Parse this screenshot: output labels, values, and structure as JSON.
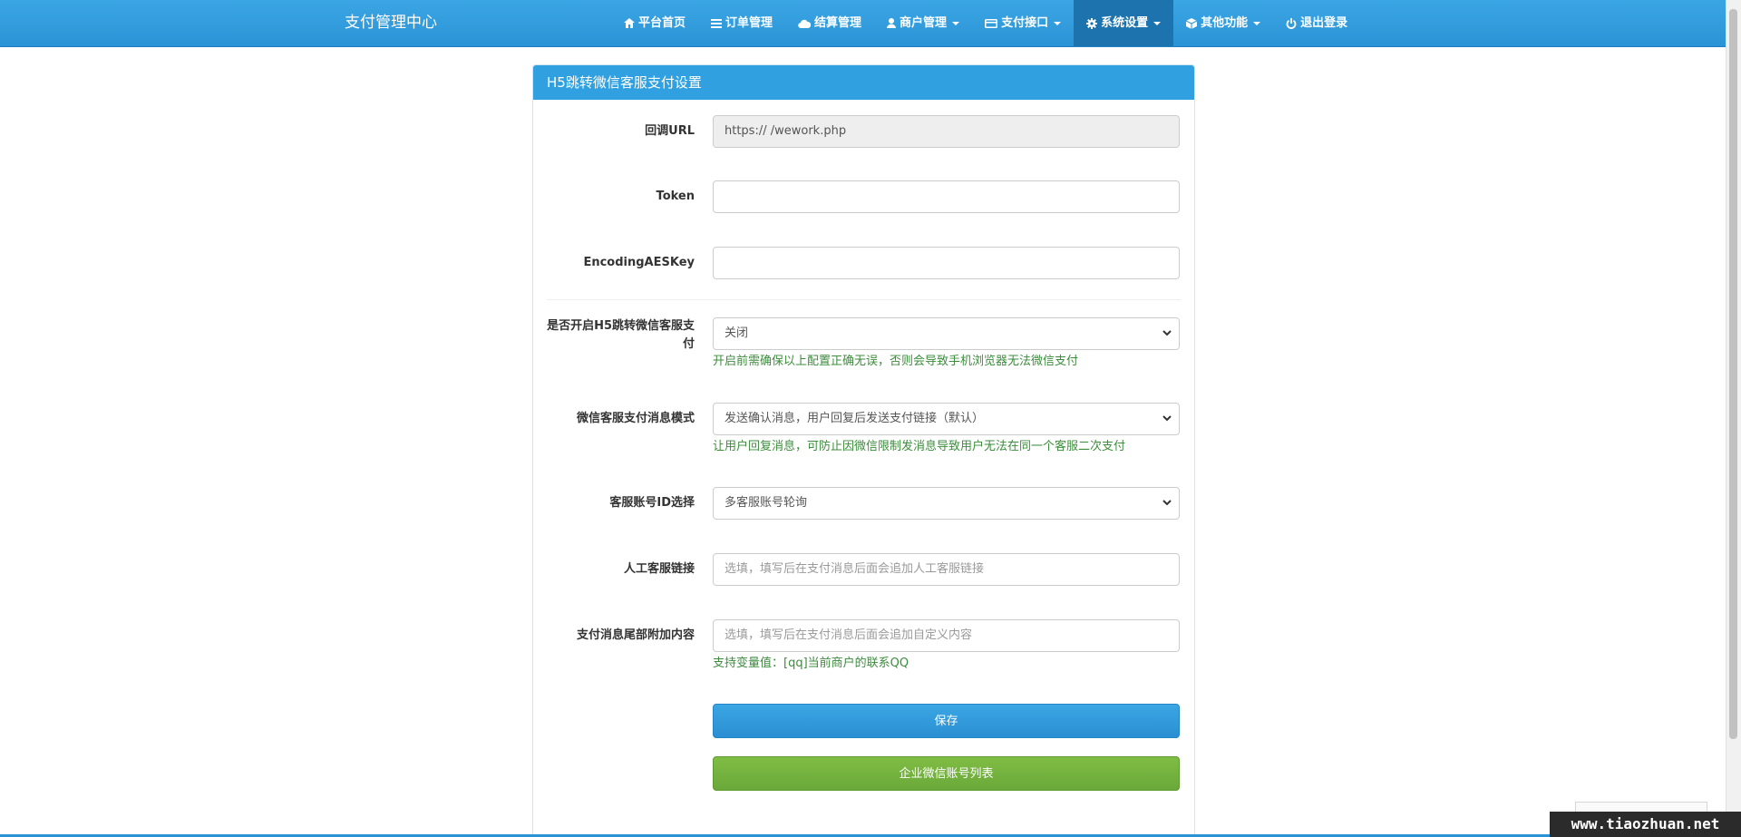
{
  "navbar": {
    "brand": "支付管理中心",
    "items": [
      {
        "label": "平台首页",
        "icon": "home-icon",
        "dropdown": false,
        "active": false
      },
      {
        "label": "订单管理",
        "icon": "list-icon",
        "dropdown": false,
        "active": false
      },
      {
        "label": "结算管理",
        "icon": "cloud-icon",
        "dropdown": false,
        "active": false
      },
      {
        "label": "商户管理",
        "icon": "user-icon",
        "dropdown": true,
        "active": false
      },
      {
        "label": "支付接口",
        "icon": "credit-card-icon",
        "dropdown": true,
        "active": false
      },
      {
        "label": "系统设置",
        "icon": "gear-icon",
        "dropdown": true,
        "active": true
      },
      {
        "label": "其他功能",
        "icon": "cube-icon",
        "dropdown": true,
        "active": false
      },
      {
        "label": "退出登录",
        "icon": "power-icon",
        "dropdown": false,
        "active": false
      }
    ]
  },
  "panel": {
    "title": "H5跳转微信客服支付设置",
    "fields": {
      "callback_url": {
        "label": "回调URL",
        "value": "https://                    /wework.php"
      },
      "token": {
        "label": "Token",
        "value": ""
      },
      "aes_key": {
        "label": "EncodingAESKey",
        "value": ""
      },
      "enable_h5": {
        "label": "是否开启H5跳转微信客服支付",
        "selected": "关闭",
        "help": "开启前需确保以上配置正确无误，否则会导致手机浏览器无法微信支付"
      },
      "message_mode": {
        "label": "微信客服支付消息模式",
        "selected": "发送确认消息，用户回复后发送支付链接（默认）",
        "help": "让用户回复消息，可防止因微信限制发消息导致用户无法在同一个客服二次支付"
      },
      "account_select": {
        "label": "客服账号ID选择",
        "selected": "多客服账号轮询"
      },
      "manual_link": {
        "label": "人工客服链接",
        "placeholder": "选填，填写后在支付消息后面会追加人工客服链接"
      },
      "tail_content": {
        "label": "支付消息尾部附加内容",
        "placeholder": "选填，填写后在支付消息后面会追加自定义内容",
        "help": "支持变量值：[qq]当前商户的联系QQ"
      }
    },
    "buttons": {
      "save": "保存",
      "account_list": "企业微信账号列表"
    }
  },
  "watermark": "www.tiaozhuan.net",
  "colors": {
    "primary": "#30a0e0",
    "success": "#72ad3c",
    "help_text": "#3c8d3c"
  }
}
